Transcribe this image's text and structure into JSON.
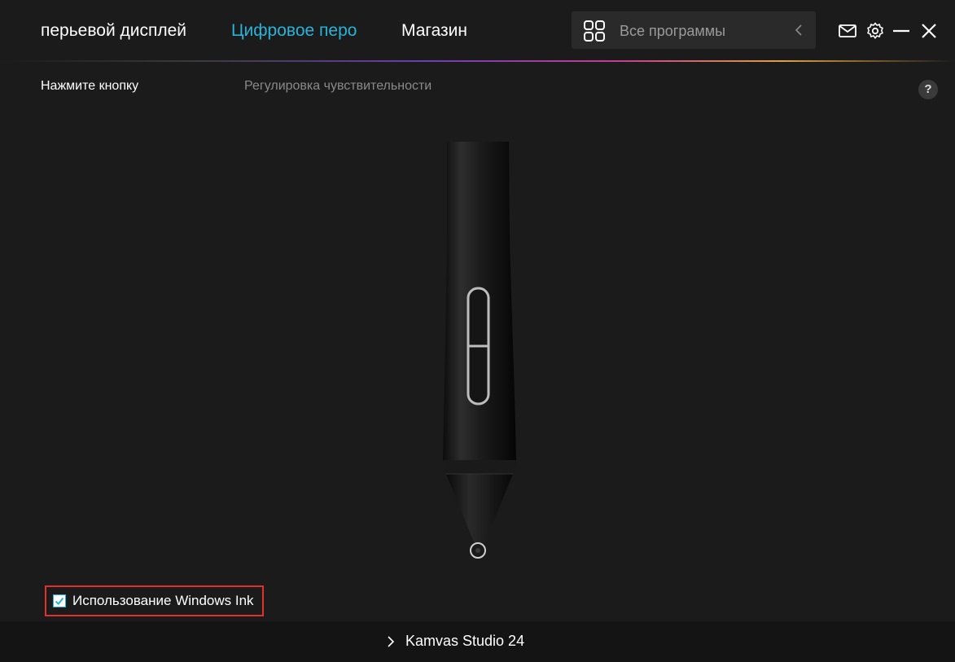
{
  "nav": {
    "tabs": [
      {
        "label": "перьевой дисплей",
        "active": false
      },
      {
        "label": "Цифровое перо",
        "active": true
      },
      {
        "label": "Магазин",
        "active": false
      }
    ]
  },
  "search": {
    "label": "Все программы"
  },
  "subnav": {
    "tabs": [
      {
        "label": "Нажмите кнопку",
        "active": true
      },
      {
        "label": "Регулировка чувствительности",
        "active": false
      }
    ],
    "help_label": "?"
  },
  "windows_ink": {
    "label": "Использование Windows Ink",
    "checked": true
  },
  "footer": {
    "device_label": "Kamvas Studio 24"
  },
  "icons": {
    "grid": "apps-grid-icon",
    "mail": "mail-icon",
    "settings": "gear-icon",
    "minimize": "minimize-icon",
    "close": "close-icon"
  },
  "colors": {
    "accent": "#27b4d8",
    "background": "#1b1b1b",
    "footer_background": "#141414",
    "highlight_border": "#e0312b",
    "inactive_text": "#8a8a8a"
  }
}
